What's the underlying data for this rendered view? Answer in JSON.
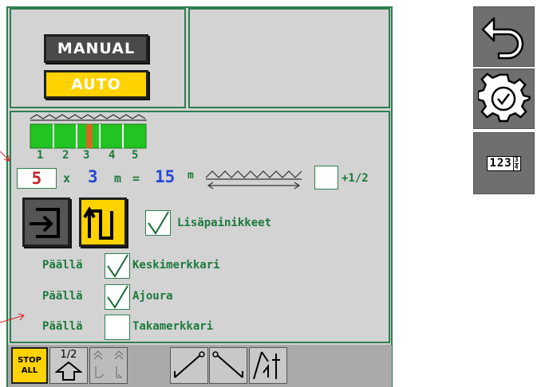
{
  "mode": {
    "manual_label": "MANUAL",
    "auto_label": "AUTO"
  },
  "boom": {
    "section_labels": [
      "1",
      "2",
      "3",
      "4",
      "5"
    ]
  },
  "calc": {
    "sections": "5",
    "x": "x",
    "width": "3",
    "m1": "m",
    "eq": "=",
    "total": "15",
    "m2": "m",
    "half_label": "+1/2"
  },
  "extra_buttons": {
    "label": "Lisäpainikkeet"
  },
  "markers": [
    {
      "state": "Päällä",
      "label": "Keskimerkkari",
      "checked": true
    },
    {
      "state": "Päällä",
      "label": "Ajoura",
      "checked": true
    },
    {
      "state": "Päällä",
      "label": "Takamerkkari",
      "checked": false
    }
  ],
  "toolbar": {
    "stop_line1": "STOP",
    "stop_line2": "ALL",
    "half_label": "1/2"
  },
  "side": {
    "counter_icon_text": "123"
  },
  "colors": {
    "panel_border": "#2e7d4f",
    "panel_bg": "#d3d3d3",
    "accent_yellow": "#ffd200",
    "section_green": "#22c422",
    "section_active": "#d2691e",
    "number_red": "#c0282a",
    "number_blue": "#2747d6"
  }
}
